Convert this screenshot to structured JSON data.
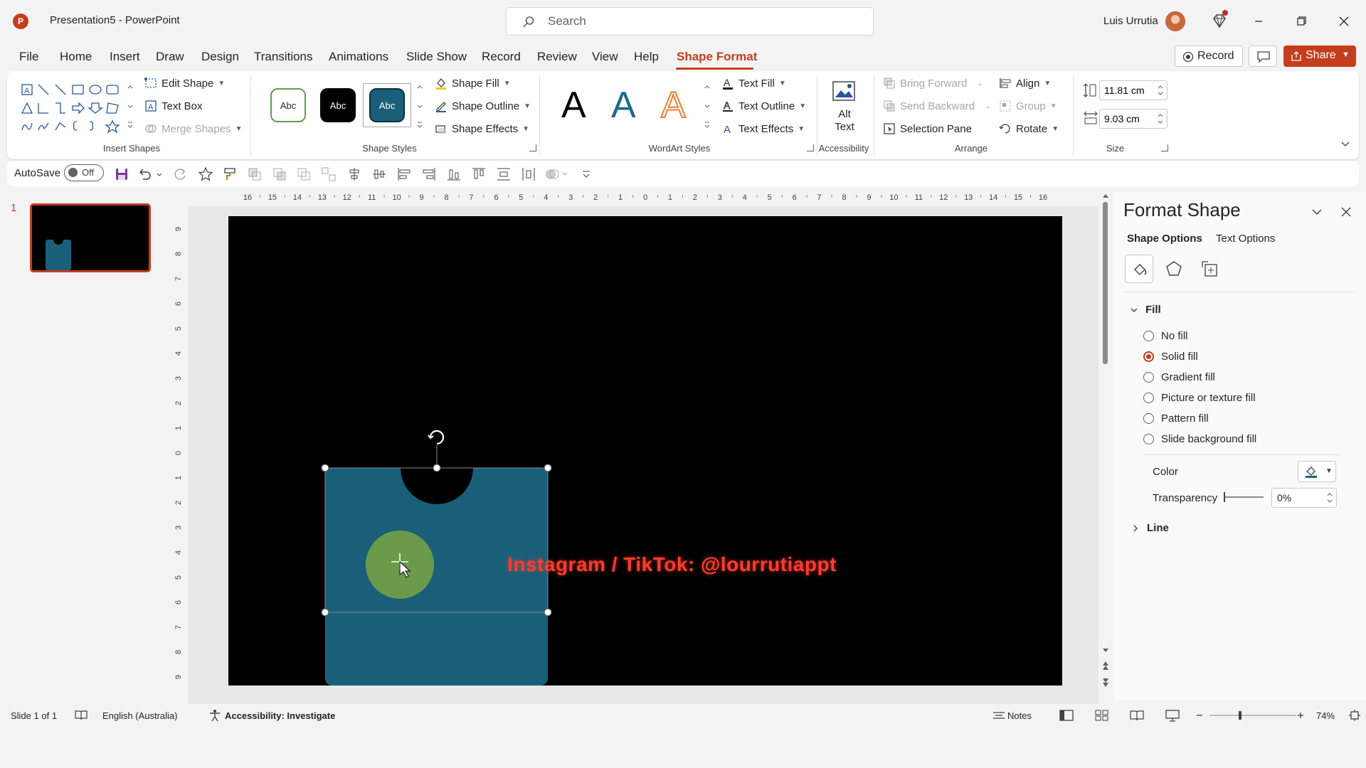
{
  "window": {
    "app_logo": "P",
    "title": "Presentation5  -  PowerPoint",
    "search_placeholder": "Search",
    "user_name": "Luis Urrutia"
  },
  "tabs": [
    {
      "label": "File"
    },
    {
      "label": "Home"
    },
    {
      "label": "Insert"
    },
    {
      "label": "Draw"
    },
    {
      "label": "Design"
    },
    {
      "label": "Transitions"
    },
    {
      "label": "Animations"
    },
    {
      "label": "Slide Show"
    },
    {
      "label": "Record"
    },
    {
      "label": "Review"
    },
    {
      "label": "View"
    },
    {
      "label": "Help"
    },
    {
      "label": "Shape Format",
      "active": true
    }
  ],
  "actions": {
    "record_label": "Record",
    "share_label": "Share"
  },
  "ribbon": {
    "insert_shapes": {
      "edit_shape": "Edit Shape",
      "text_box": "Text Box",
      "merge_shapes": "Merge Shapes",
      "label": "Insert Shapes"
    },
    "shape_styles": {
      "swatch_label": "Abc",
      "shape_fill": "Shape Fill",
      "shape_outline": "Shape Outline",
      "shape_effects": "Shape Effects",
      "label": "Shape Styles"
    },
    "wordart": {
      "glyph": "A",
      "text_fill": "Text Fill",
      "text_outline": "Text Outline",
      "text_effects": "Text Effects",
      "label": "WordArt Styles"
    },
    "accessibility": {
      "alt_text_line1": "Alt",
      "alt_text_line2": "Text",
      "label": "Accessibility"
    },
    "arrange": {
      "bring_forward": "Bring Forward",
      "send_backward": "Send Backward",
      "selection_pane": "Selection Pane",
      "align": "Align",
      "group": "Group",
      "rotate": "Rotate",
      "label": "Arrange"
    },
    "size": {
      "height": "11.81 cm",
      "width": "9.03 cm",
      "label": "Size"
    }
  },
  "qat": {
    "autosave_label": "AutoSave",
    "autosave_state": "Off"
  },
  "thumbnails": {
    "slide_number": "1"
  },
  "rulers": {
    "horizontal": [
      "16",
      "15",
      "14",
      "13",
      "12",
      "11",
      "10",
      "9",
      "8",
      "7",
      "6",
      "5",
      "4",
      "3",
      "2",
      "1",
      "0",
      "1",
      "2",
      "3",
      "4",
      "5",
      "6",
      "7",
      "8",
      "9",
      "10",
      "11",
      "12",
      "13",
      "14",
      "15",
      "16"
    ],
    "vertical": [
      "9",
      "8",
      "7",
      "6",
      "5",
      "4",
      "3",
      "2",
      "1",
      "0",
      "1",
      "2",
      "3",
      "4",
      "5",
      "6",
      "7",
      "8",
      "9"
    ]
  },
  "slide": {
    "watermark_text": "Instagram / TikTok: @lourrutiappt",
    "shape_color": "#1a5f7a",
    "circle_color": "#6a9a4a",
    "background": "#000000",
    "watermark_color": "#ff3b2f"
  },
  "format_pane": {
    "title": "Format Shape",
    "tab_shape_options": "Shape Options",
    "tab_text_options": "Text Options",
    "fill_section": "Fill",
    "fill_options": [
      {
        "label": "No fill",
        "selected": false
      },
      {
        "label": "Solid fill",
        "selected": true
      },
      {
        "label": "Gradient fill",
        "selected": false
      },
      {
        "label": "Picture or texture fill",
        "selected": false
      },
      {
        "label": "Pattern fill",
        "selected": false
      },
      {
        "label": "Slide background fill",
        "selected": false
      }
    ],
    "color_label": "Color",
    "transparency_label": "Transparency",
    "transparency_value": "0%",
    "line_section": "Line"
  },
  "status": {
    "slide_of": "Slide 1 of 1",
    "language": "English (Australia)",
    "accessibility": "Accessibility: Investigate",
    "notes": "Notes",
    "zoom": "74%"
  },
  "colors": {
    "accent": "#c43e1c"
  }
}
